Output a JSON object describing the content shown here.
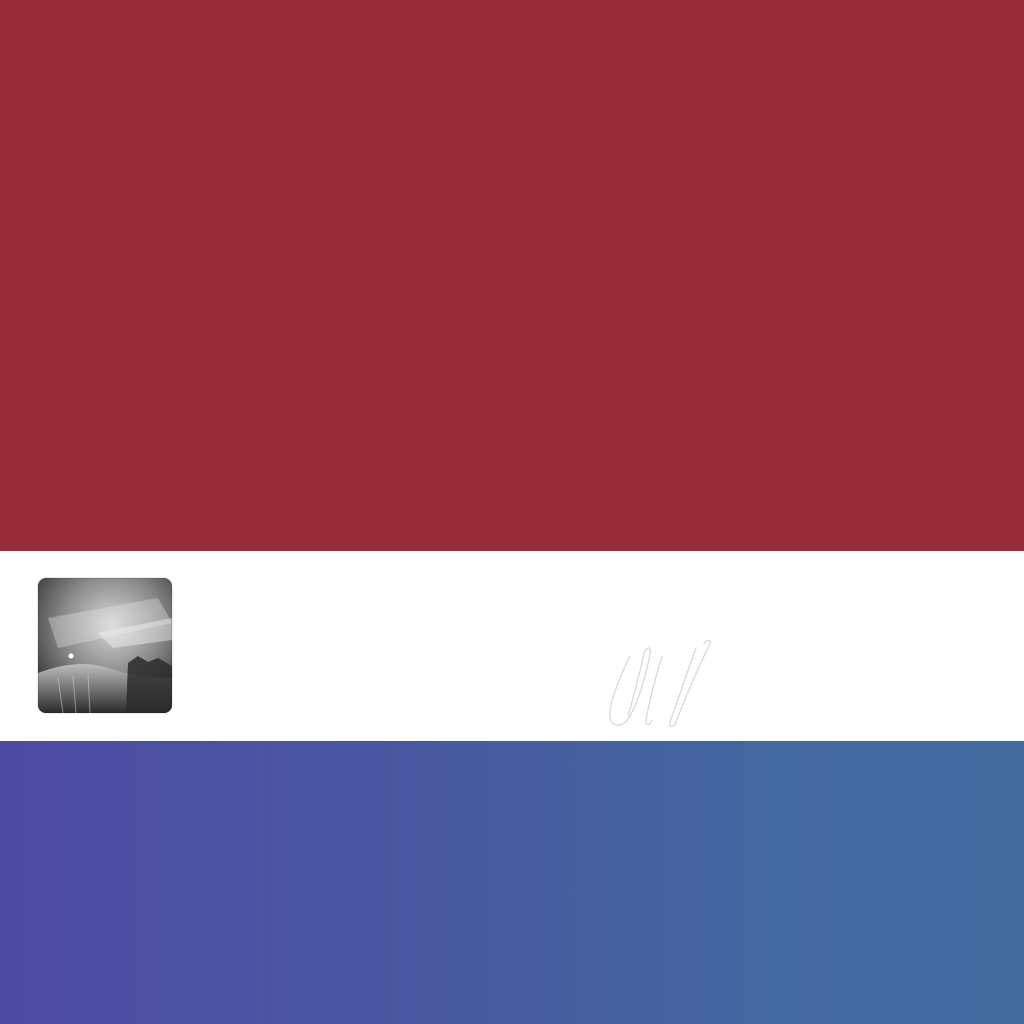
{
  "bands": {
    "top_color": "#982d39",
    "middle_color": "#ffffff",
    "bottom_gradient_start": "#4e4aa4",
    "bottom_gradient_end": "#41699c"
  },
  "thumbnail": {
    "icon": "photo-thumbnail",
    "description_colors": [
      "#1c1c1c",
      "#8a8a8a",
      "#e0e0e0"
    ]
  },
  "signature": {
    "icon": "handwritten-mark-icon",
    "stroke_color": "#d6d6d6"
  }
}
